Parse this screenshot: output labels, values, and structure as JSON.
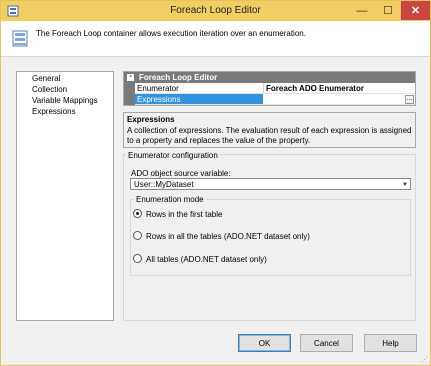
{
  "window": {
    "title": "Foreach Loop Editor",
    "controls": {
      "minimize": "—",
      "maximize": "☐",
      "close": "✕"
    }
  },
  "header": {
    "description": "The Foreach Loop container allows execution iteration over an enumeration."
  },
  "nav": {
    "items": [
      {
        "label": "General"
      },
      {
        "label": "Collection"
      },
      {
        "label": "Variable Mappings"
      },
      {
        "label": "Expressions"
      }
    ]
  },
  "property_grid": {
    "category": "Foreach Loop Editor",
    "collapse_glyph": "-",
    "rows": [
      {
        "key": "Enumerator",
        "value": "Foreach ADO Enumerator"
      },
      {
        "key": "Expressions",
        "value": ""
      }
    ],
    "ellipsis": "..."
  },
  "help": {
    "title": "Expressions",
    "text": "A collection of expressions. The evaluation result of each expression is assigned to a property and replaces the value of the property."
  },
  "enumerator_config": {
    "legend": "Enumerator configuration",
    "source_label": "ADO object source variable:",
    "source_value": "User::MyDataset",
    "dropdown_arrow": "▼",
    "mode_legend": "Enumeration mode",
    "modes": [
      {
        "label": "Rows in the first table",
        "selected": true
      },
      {
        "label": "Rows in all the tables (ADO.NET dataset only)",
        "selected": false
      },
      {
        "label": "All tables (ADO.NET dataset only)",
        "selected": false
      }
    ]
  },
  "buttons": {
    "ok": "OK",
    "cancel": "Cancel",
    "help": "Help"
  },
  "colors": {
    "titlebar": "#f2cd62",
    "selection": "#3393df",
    "category": "#7a7a7a"
  }
}
